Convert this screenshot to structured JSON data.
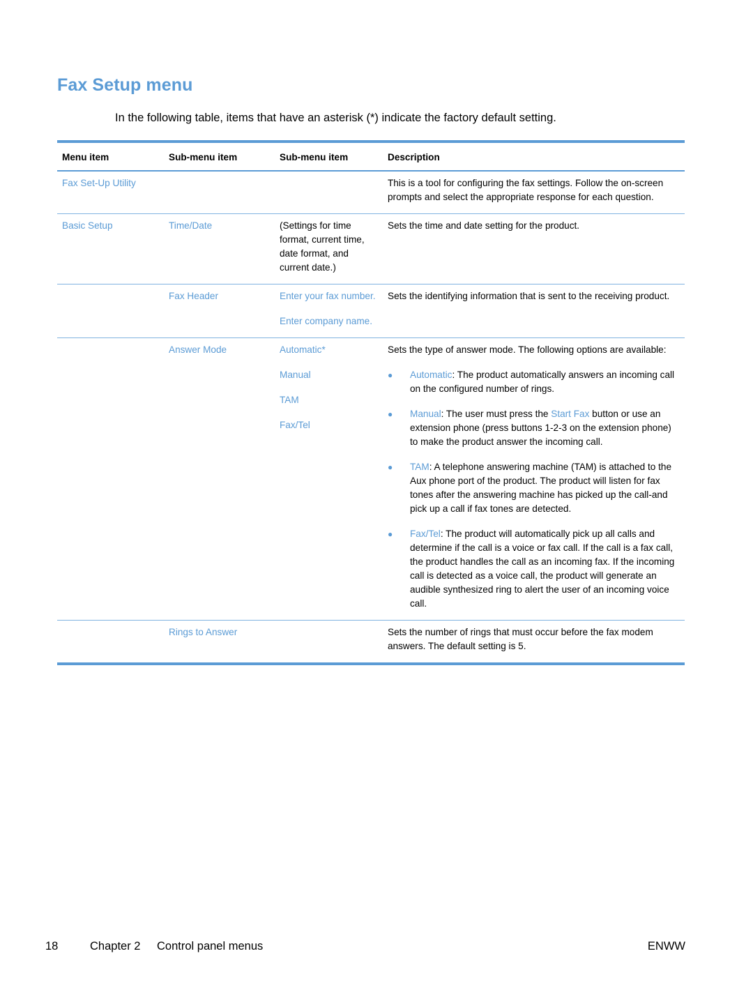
{
  "page": {
    "title": "Fax Setup menu",
    "intro": "In the following table, items that have an asterisk (*) indicate the factory default setting."
  },
  "table": {
    "headers": [
      "Menu item",
      "Sub-menu item",
      "Sub-menu item",
      "Description"
    ],
    "rows": [
      {
        "menu_item": "Fax Set-Up Utility",
        "sub1": "",
        "sub2": [],
        "description": "This is a tool for configuring the fax settings. Follow the on-screen prompts and select the appropriate response for each question."
      },
      {
        "menu_item": "Basic Setup",
        "sub1": "Time/Date",
        "sub2_plain": "(Settings for time format, current time, date format, and current date.)",
        "description": "Sets the time and date setting for the product."
      },
      {
        "menu_item": "",
        "sub1": "Fax Header",
        "sub2": [
          "Enter your fax number.",
          "Enter company name."
        ],
        "description": "Sets the identifying information that is sent to the receiving product."
      },
      {
        "menu_item": "",
        "sub1": "Answer Mode",
        "sub2": [
          "Automatic*",
          "Manual",
          "TAM",
          "Fax/Tel"
        ],
        "description": "Sets the type of answer mode. The following options are available:",
        "bullets": [
          {
            "term": "Automatic",
            "text": ": The product automatically answers an incoming call on the configured number of rings."
          },
          {
            "term": "Manual",
            "text_before": ": The user must press the ",
            "link": "Start Fax",
            "text_after": " button or use an extension phone (press buttons 1-2-3 on the extension phone) to make the product answer the incoming call."
          },
          {
            "term": "TAM",
            "text": ": A telephone answering machine (TAM) is attached to the Aux phone port of the product. The product will listen for fax tones after the answering machine has picked up the call-and pick up a call if fax tones are detected."
          },
          {
            "term": "Fax/Tel",
            "text": ": The product will automatically pick up all calls and determine if the call is a voice or fax call. If the call is a fax call, the product handles the call as an incoming fax. If the incoming call is detected as a voice call, the product will generate an audible synthesized ring to alert the user of an incoming voice call."
          }
        ]
      },
      {
        "menu_item": "",
        "sub1": "Rings to Answer",
        "sub2": [],
        "description": "Sets the number of rings that must occur before the fax modem answers. The default setting is 5."
      }
    ]
  },
  "footer": {
    "page_number": "18",
    "chapter": "Chapter 2",
    "chapter_name": "Control panel menus",
    "locale": "ENWW"
  },
  "colors": {
    "accent": "#5b9bd5",
    "rule": "#7fb2e0"
  },
  "icons": {
    "bullet": "●"
  }
}
